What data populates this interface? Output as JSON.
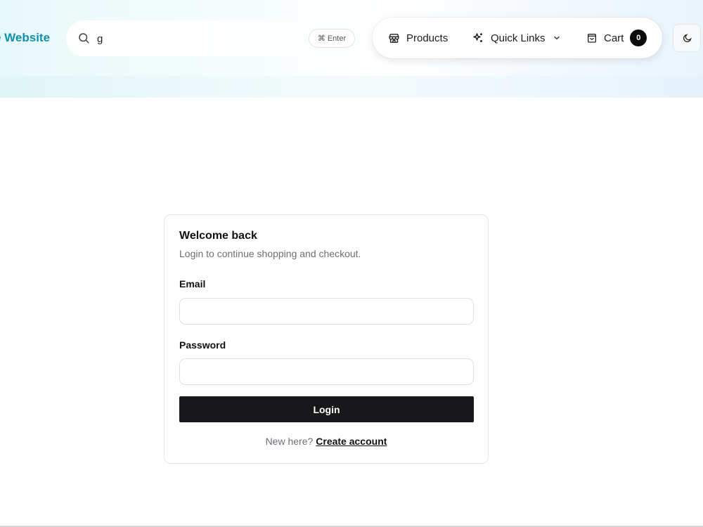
{
  "header": {
    "brand": "e Website",
    "search": {
      "value": "g",
      "placeholder": "",
      "shortcut_symbol": "⌘",
      "shortcut_label": "Enter"
    },
    "nav": {
      "products_label": "Products",
      "quick_links_label": "Quick Links",
      "cart_label": "Cart",
      "cart_count": "0"
    },
    "theme_icon": "moon-icon"
  },
  "login": {
    "title": "Welcome back",
    "subtitle": "Login to continue shopping and checkout.",
    "email_label": "Email",
    "email_value": "",
    "password_label": "Password",
    "password_value": "",
    "submit_label": "Login",
    "signup_prompt": "New here?",
    "signup_link": "Create account"
  },
  "colors": {
    "brand": "#0e8fb0",
    "primary_button": "#18181b",
    "badge": "#0b0b0b"
  }
}
